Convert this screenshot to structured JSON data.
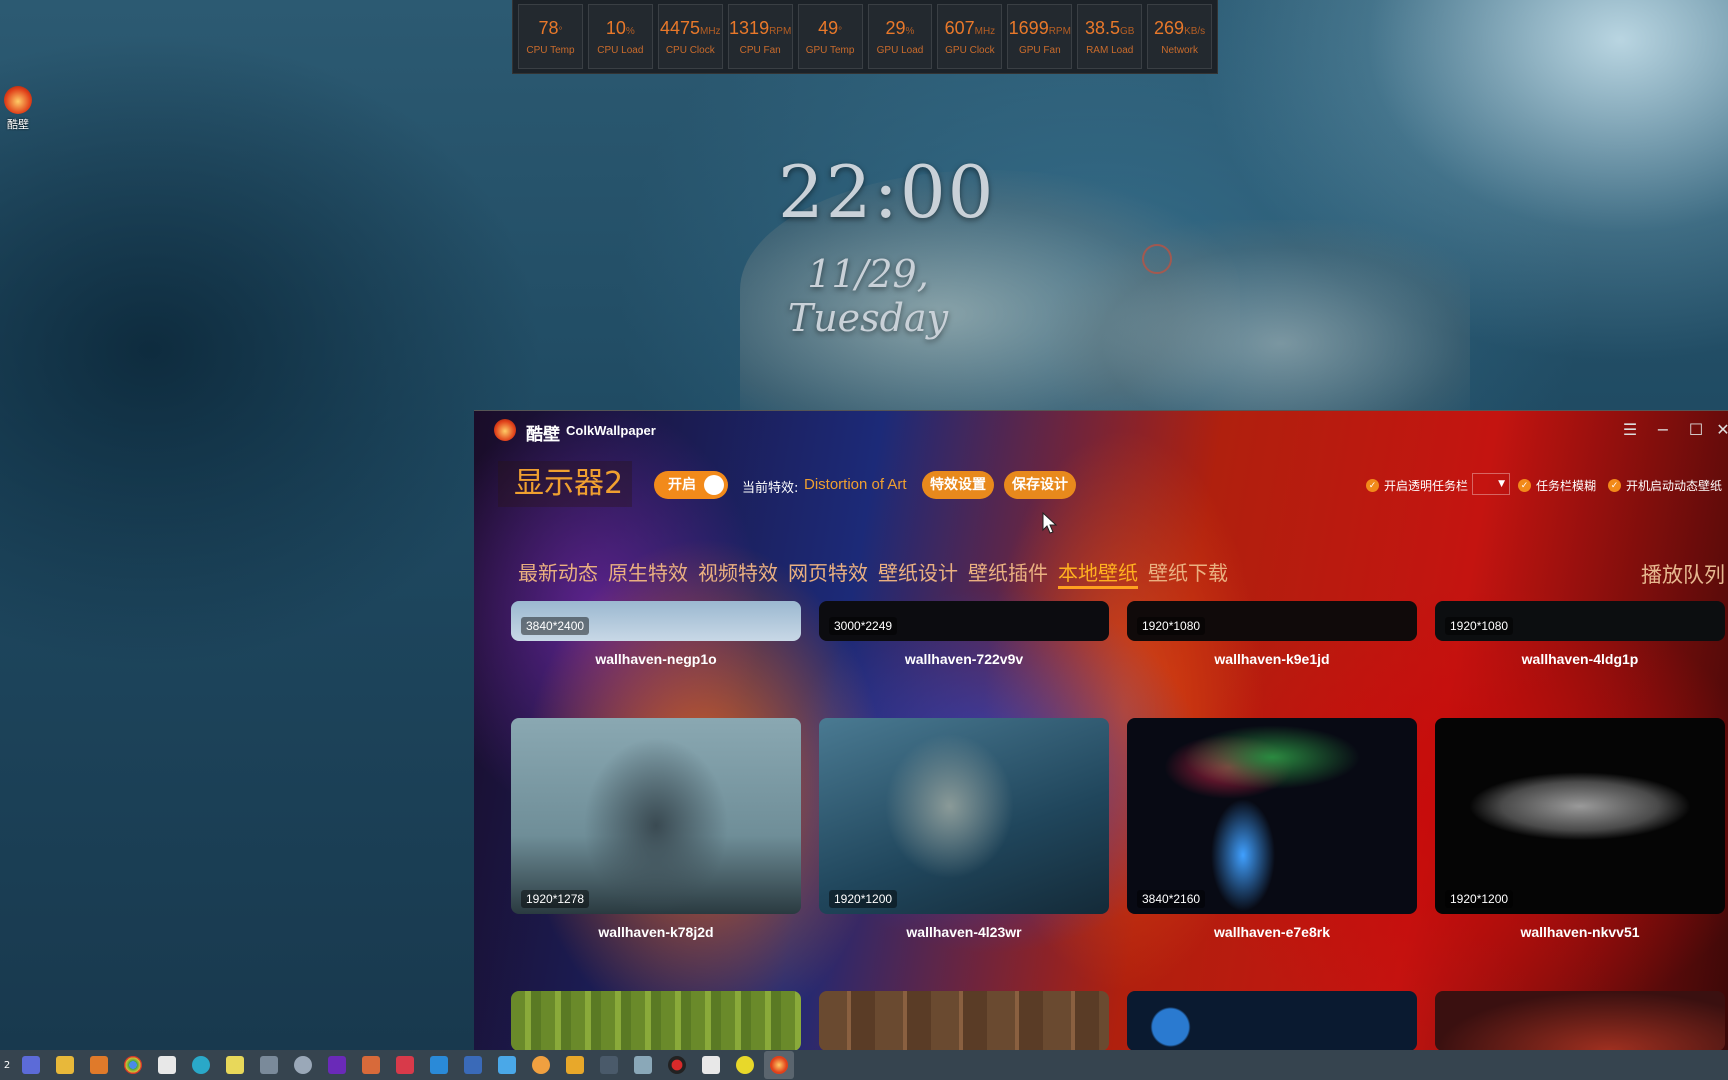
{
  "hardware_monitor": [
    {
      "value": "78",
      "unit": "°",
      "label": "CPU Temp"
    },
    {
      "value": "10",
      "unit": "%",
      "label": "CPU Load"
    },
    {
      "value": "4475",
      "unit": "MHz",
      "label": "CPU Clock"
    },
    {
      "value": "1319",
      "unit": "RPM",
      "label": "CPU Fan"
    },
    {
      "value": "49",
      "unit": "°",
      "label": "GPU Temp"
    },
    {
      "value": "29",
      "unit": "%",
      "label": "GPU Load"
    },
    {
      "value": "607",
      "unit": "MHz",
      "label": "GPU Clock"
    },
    {
      "value": "1699",
      "unit": "RPM",
      "label": "GPU Fan"
    },
    {
      "value": "38.5",
      "unit": "GB",
      "label": "RAM Load"
    },
    {
      "value": "269",
      "unit": "KB/s",
      "label": "Network"
    }
  ],
  "desktop": {
    "icon_label": "酷壁",
    "clock_time": "22:00",
    "clock_date": "11/29, Tuesday"
  },
  "app": {
    "title_cn": "酷壁",
    "title_en": "ColkWallpaper",
    "monitor_name": "显示器2",
    "toggle_label": "开启",
    "current_effect_label": "当前特效:",
    "current_effect_value": "Distortion of Art",
    "effect_settings_button": "特效设置",
    "save_design_button": "保存设计",
    "options": {
      "transparent_taskbar": "开启透明任务栏",
      "taskbar_blur": "任务栏模糊",
      "autostart_wallpaper": "开机启动动态壁纸"
    },
    "tabs": [
      "最新动态",
      "原生特效",
      "视频特效",
      "网页特效",
      "壁纸设计",
      "壁纸插件",
      "本地壁纸",
      "壁纸下载"
    ],
    "active_tab": "本地壁纸",
    "play_queue": "播放队列",
    "wallpapers_row1": [
      {
        "res": "3840*2400",
        "name": "wallhaven-negp1o"
      },
      {
        "res": "3000*2249",
        "name": "wallhaven-722v9v"
      },
      {
        "res": "1920*1080",
        "name": "wallhaven-k9e1jd"
      },
      {
        "res": "1920*1080",
        "name": "wallhaven-4ldg1p"
      }
    ],
    "wallpapers_row2": [
      {
        "res": "1920*1278",
        "name": "wallhaven-k78j2d"
      },
      {
        "res": "1920*1200",
        "name": "wallhaven-4l23wr"
      },
      {
        "res": "3840*2160",
        "name": "wallhaven-e7e8rk"
      },
      {
        "res": "1920*1200",
        "name": "wallhaven-nkvv51"
      }
    ]
  },
  "taskbar": {
    "first_label": "2",
    "icons": [
      "file-icon",
      "store-icon",
      "folder-icon",
      "search-icon",
      "chrome-icon",
      "calendar-icon",
      "edge-icon",
      "notes-icon",
      "calculator-icon",
      "settings-icon",
      "next-icon",
      "puzzle-icon",
      "sign-icon",
      "vscode-icon",
      "remote-icon",
      "cloud-icon",
      "ball-icon",
      "box-icon",
      "grid-icon",
      "bird-icon",
      "record-icon",
      "pen-icon",
      "smile-icon",
      "wallpaper-icon"
    ]
  }
}
